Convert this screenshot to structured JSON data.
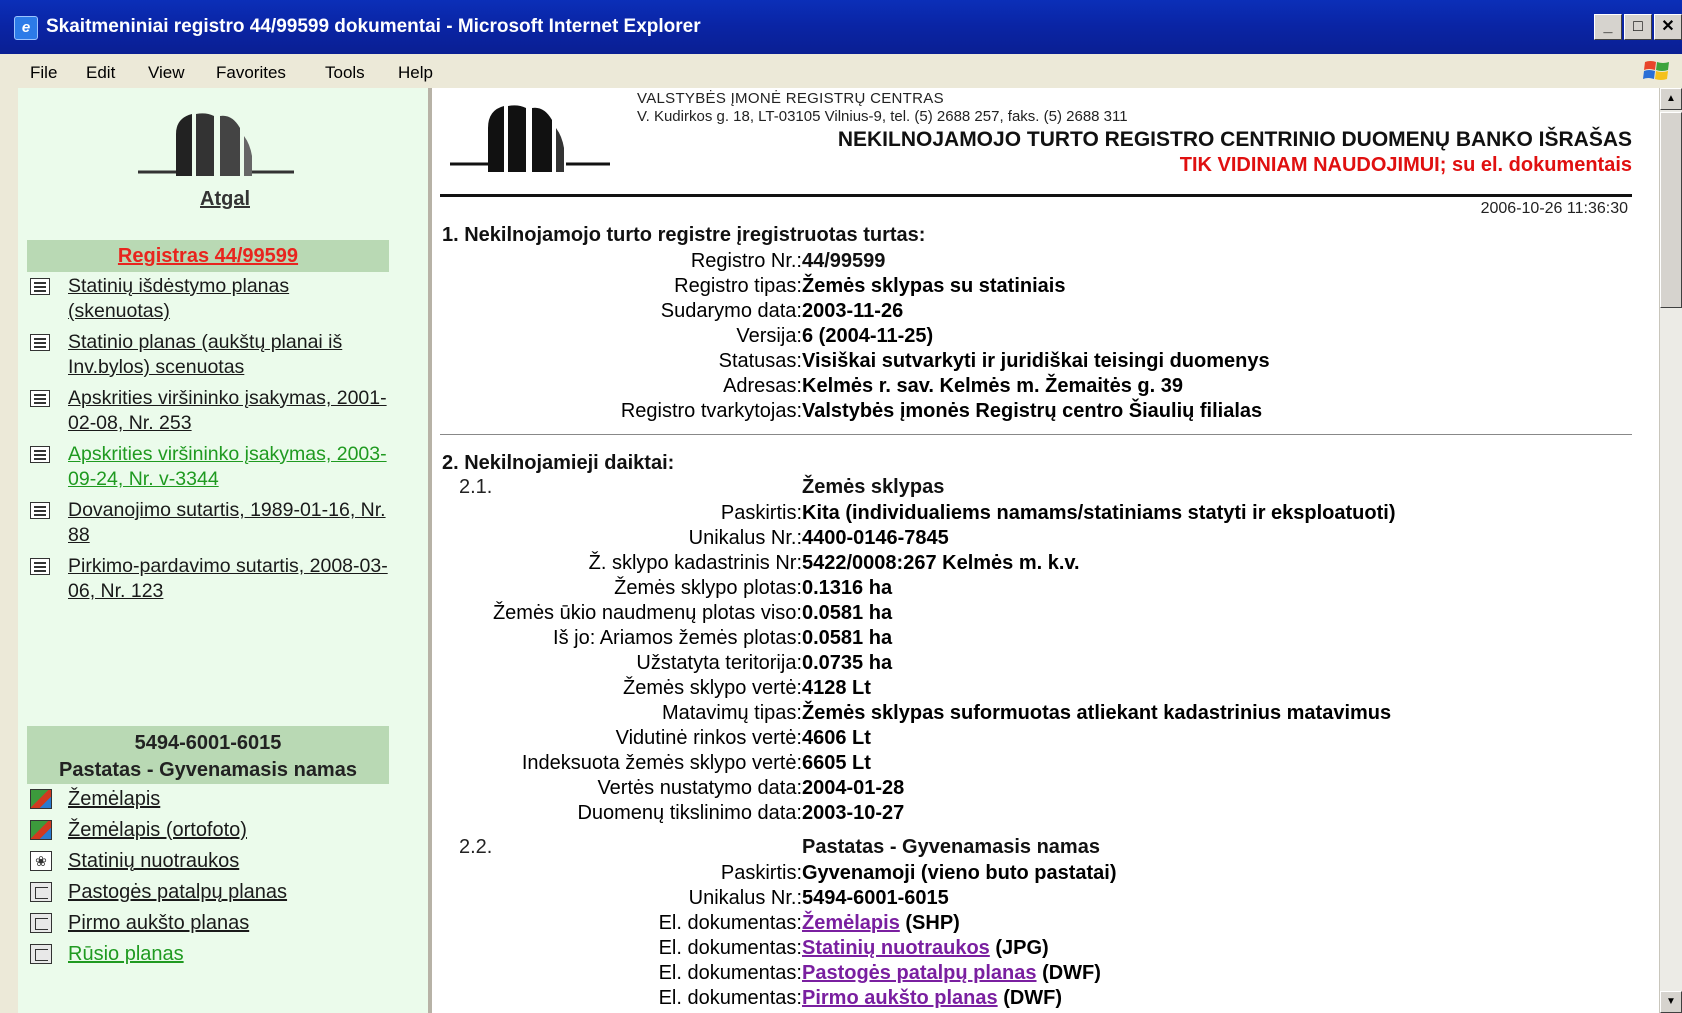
{
  "window": {
    "title": "Skaitmeniniai registro 44/99599 dokumentai - Microsoft Internet Explorer",
    "icon": "ie-icon",
    "controls": [
      "_",
      "□",
      "✕"
    ]
  },
  "menubar": {
    "items": [
      {
        "label": "File"
      },
      {
        "label": "Edit"
      },
      {
        "label": "View"
      },
      {
        "label": "Favorites"
      },
      {
        "label": "Tools"
      },
      {
        "label": "Help"
      }
    ]
  },
  "sidebar": {
    "back_label": "Atgal",
    "registry_header": "Registras 44/99599",
    "documents": [
      {
        "label": "Statinių išdėstymo planas (skenuotas)",
        "visited": false
      },
      {
        "label": "Statinio planas (aukštų planai iš Inv.bylos) scenuotas",
        "visited": false
      },
      {
        "label": "Apskrities viršininko įsakymas, 2001-02-08, Nr. 253",
        "visited": false
      },
      {
        "label": "Apskrities viršininko įsakymas, 2003-09-24, Nr. v-3344",
        "visited": true
      },
      {
        "label": "Dovanojimo sutartis, 1989-01-16, Nr. 88",
        "visited": false
      },
      {
        "label": "Pirkimo-pardavimo sutartis, 2008-03-06, Nr. 123",
        "visited": false
      }
    ],
    "building_header_line1": "5494-6001-6015",
    "building_header_line2": "Pastatas - Gyvenamasis namas",
    "building_items": [
      {
        "label": "Žemėlapis",
        "icon": "map-icon",
        "visited": false
      },
      {
        "label": "Žemėlapis (ortofoto)",
        "icon": "map-icon",
        "visited": false
      },
      {
        "label": "Statinių nuotraukos",
        "icon": "photo-icon",
        "visited": false
      },
      {
        "label": "Pastogės patalpų planas",
        "icon": "plan-icon",
        "visited": false
      },
      {
        "label": "Pirmo aukšto planas",
        "icon": "plan-icon",
        "visited": false
      },
      {
        "label": "Rūsio planas",
        "icon": "plan-icon",
        "visited": true
      }
    ]
  },
  "document": {
    "org_name": "VALSTYBĖS ĮMONĖ REGISTRŲ CENTRAS",
    "org_address": "V. Kudirkos g. 18, LT-03105 Vilnius-9, tel. (5) 2688 257, faks. (5) 2688 311",
    "title": "NEKILNOJAMOJO TURTO REGISTRO CENTRINIO DUOMENŲ BANKO IŠRAŠAS",
    "subtitle": "TIK VIDINIAM NAUDOJIMUI; su el. dokumentais",
    "timestamp": "2006-10-26 11:36:30",
    "section1": {
      "title": "1. Nekilnojamojo turto registre įregistruotas turtas:",
      "rows": [
        {
          "label": "Registro Nr.:",
          "value": "44/99599"
        },
        {
          "label": "Registro tipas:",
          "value": "Žemės sklypas su statiniais"
        },
        {
          "label": "Sudarymo data:",
          "value": "2003-11-26"
        },
        {
          "label": "Versija:",
          "value": "6 (2004-11-25)"
        },
        {
          "label": "Statusas:",
          "value": "Visiškai sutvarkyti ir juridiškai teisingi duomenys"
        },
        {
          "label": "Adresas:",
          "value": "Kelmės r. sav. Kelmės m. Žemaitės g. 39"
        },
        {
          "label": "Registro tvarkytojas:",
          "value": "Valstybės įmonės Registrų centro Šiaulių filialas"
        }
      ]
    },
    "section2": {
      "title": "2. Nekilnojamieji daiktai:",
      "objects": [
        {
          "num": "2.1.",
          "title": "Žemės sklypas",
          "rows": [
            {
              "label": "Paskirtis:",
              "value": "Kita (individualiems namams/statiniams statyti ir eksploatuoti)"
            },
            {
              "label": "Unikalus Nr.:",
              "value": "4400-0146-7845"
            },
            {
              "label": "Ž. sklypo kadastrinis Nr:",
              "value": "5422/0008:267 Kelmės m. k.v."
            },
            {
              "label": "Žemės sklypo plotas:",
              "value": "0.1316 ha"
            },
            {
              "label": "Žemės ūkio naudmenų plotas viso:",
              "value": "0.0581 ha"
            },
            {
              "label": "Iš jo: Ariamos žemės plotas:",
              "value": "0.0581 ha"
            },
            {
              "label": "Užstatyta teritorija:",
              "value": "0.0735 ha"
            },
            {
              "label": "Žemės sklypo vertė:",
              "value": "4128 Lt"
            },
            {
              "label": "Matavimų tipas:",
              "value": "Žemės sklypas suformuotas atliekant kadastrinius matavimus"
            },
            {
              "label": "Vidutinė rinkos vertė:",
              "value": "4606 Lt"
            },
            {
              "label": "Indeksuota žemės sklypo vertė:",
              "value": "6605 Lt"
            },
            {
              "label": "Vertės nustatymo data:",
              "value": "2004-01-28"
            },
            {
              "label": "Duomenų tikslinimo data:",
              "value": "2003-10-27"
            }
          ]
        },
        {
          "num": "2.2.",
          "title": "Pastatas - Gyvenamasis namas",
          "rows": [
            {
              "label": "Paskirtis:",
              "value": "Gyvenamoji (vieno buto pastatai)"
            },
            {
              "label": "Unikalus Nr.:",
              "value": "5494-6001-6015"
            }
          ],
          "edocs": [
            {
              "label": "El. dokumentas:",
              "link": "Žemėlapis",
              "type": "(SHP)"
            },
            {
              "label": "El. dokumentas:",
              "link": "Statinių nuotraukos",
              "type": "(JPG)"
            },
            {
              "label": "El. dokumentas:",
              "link": "Pastogės patalpų planas",
              "type": "(DWF)"
            },
            {
              "label": "El. dokumentas:",
              "link": "Pirmo aukšto planas",
              "type": "(DWF)"
            }
          ]
        }
      ]
    }
  }
}
